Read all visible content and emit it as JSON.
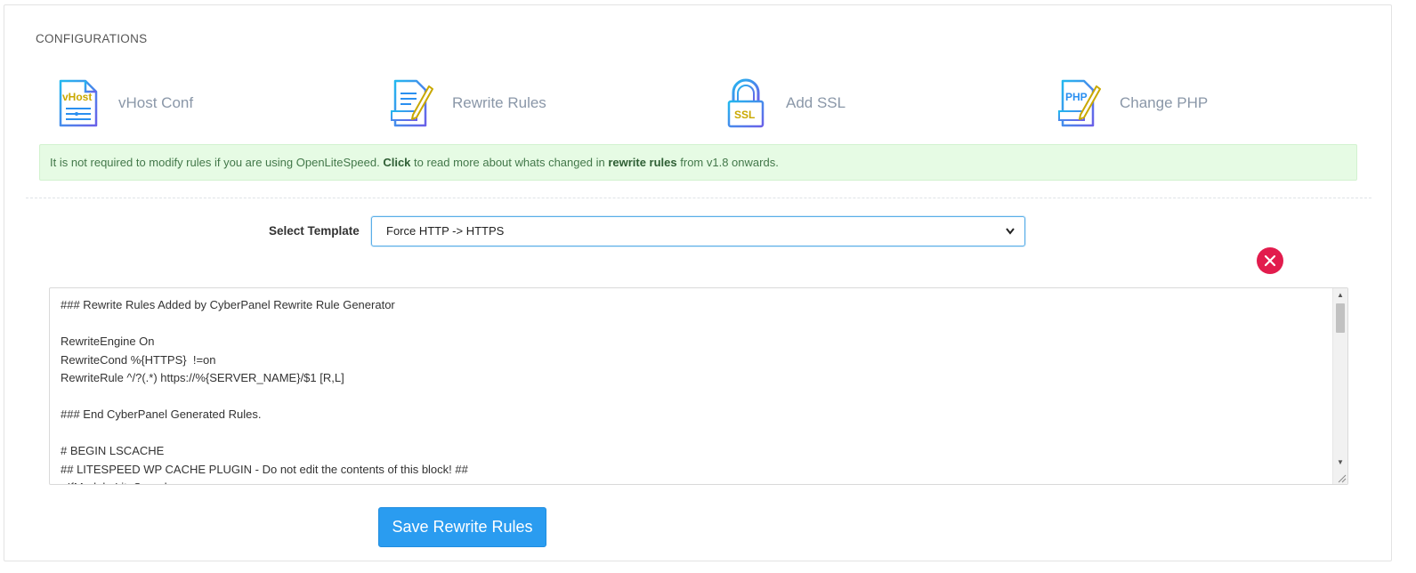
{
  "section": {
    "title": "CONFIGURATIONS"
  },
  "configs": [
    {
      "label": "vHost Conf",
      "icon": "vhost-file-icon"
    },
    {
      "label": "Rewrite Rules",
      "icon": "rewrite-file-pencil-icon"
    },
    {
      "label": "Add SSL",
      "icon": "ssl-padlock-icon"
    },
    {
      "label": "Change PHP",
      "icon": "php-file-pencil-icon"
    }
  ],
  "notice": {
    "text_1": "It is not required to modify rules if you are using OpenLiteSpeed.",
    "link_click": "Click",
    "text_2": "to read more about whats changed in",
    "link_rules": "rewrite rules",
    "text_3": "from v1.8 onwards."
  },
  "template": {
    "label": "Select Template",
    "selected": "Force HTTP -> HTTPS"
  },
  "editor": {
    "content": "### Rewrite Rules Added by CyberPanel Rewrite Rule Generator\n\nRewriteEngine On\nRewriteCond %{HTTPS}  !=on\nRewriteRule ^/?(.*) https://%{SERVER_NAME}/$1 [R,L]\n\n### End CyberPanel Generated Rules.\n\n# BEGIN LSCACHE\n## LITESPEED WP CACHE PLUGIN - Do not edit the contents of this block! ##\n<IfModule LiteSpeed>"
  },
  "actions": {
    "save_label": "Save Rewrite Rules"
  },
  "colors": {
    "accent": "#2a9cf0",
    "danger": "#e21c4d",
    "notice_bg": "#e6fbe4",
    "icon_blue": "#2a8ff0",
    "icon_gold": "#c9a800"
  }
}
